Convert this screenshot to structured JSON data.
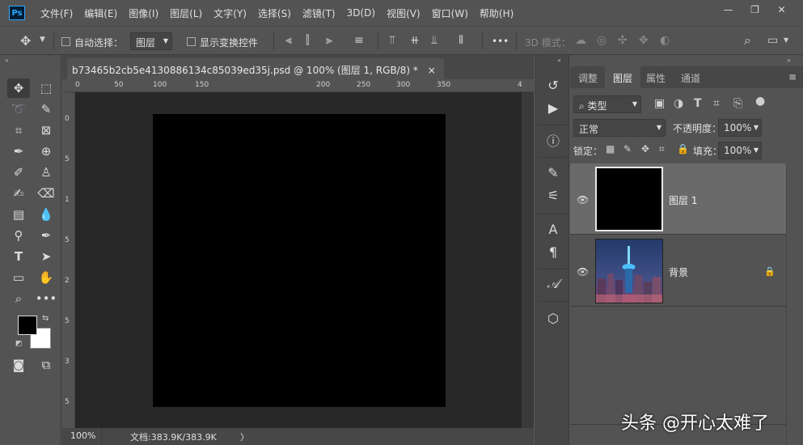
{
  "app": {
    "logo": "Ps"
  },
  "menu": [
    "文件(F)",
    "编辑(E)",
    "图像(I)",
    "图层(L)",
    "文字(Y)",
    "选择(S)",
    "滤镜(T)",
    "3D(D)",
    "视图(V)",
    "窗口(W)",
    "帮助(H)"
  ],
  "window_controls": {
    "minimize": "—",
    "restore": "❐",
    "close": "✕"
  },
  "options": {
    "auto_select_label": "自动选择：",
    "auto_select_value": "图层",
    "show_transform_label": "显示变换控件",
    "mode_3d_label": "3D 模式：",
    "more": "•••"
  },
  "document": {
    "tab_title": "b73465b2cb5e4130886134c85039ed35j.psd @ 100% (图层 1, RGB/8) *",
    "close": "×",
    "ruler_top": [
      "0",
      "50",
      "100",
      "150",
      "200",
      "250",
      "300",
      "350",
      "4"
    ],
    "ruler_left": [
      "0",
      "5",
      "1",
      "5",
      "2",
      "5",
      "3",
      "5"
    ]
  },
  "status": {
    "zoom": "100%",
    "doc_info": "文档:383.9K/383.9K",
    "arrow": "〉"
  },
  "layers_panel": {
    "tabs": [
      "调整",
      "图层",
      "属性",
      "通道"
    ],
    "active_tab": "图层",
    "filter_kind": "类型",
    "blend_mode": "正常",
    "opacity_label": "不透明度：",
    "opacity_value": "100%",
    "lock_label": "锁定：",
    "fill_label": "填充：",
    "fill_value": "100%",
    "layers": [
      {
        "name": "图层 1",
        "selected": true
      },
      {
        "name": "背景",
        "locked": true
      }
    ]
  },
  "watermark": "头条 @开心太难了",
  "colors": {
    "foreground": "#000000",
    "background": "#ffffff"
  }
}
